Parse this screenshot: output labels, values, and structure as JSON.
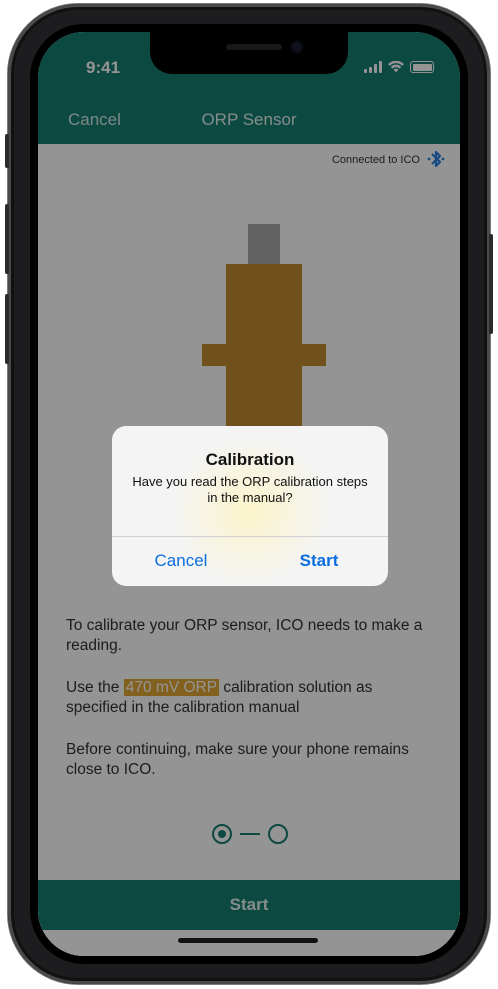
{
  "status": {
    "time": "9:41"
  },
  "nav": {
    "cancel_label": "Cancel",
    "title": "ORP Sensor"
  },
  "connection": {
    "text": "Connected to ICO",
    "icon": "bluetooth-icon"
  },
  "instructions": {
    "p1": "To calibrate your ORP sensor, ICO needs to make a reading.",
    "p2_prefix": "Use the ",
    "p2_highlight": "470 mV ORP",
    "p2_suffix": " calibration solution as specified in the calibration manual",
    "p3": "Before continuing, make sure your phone remains close to ICO."
  },
  "pagination": {
    "current": 1,
    "total": 2
  },
  "bottom": {
    "start_label": "Start"
  },
  "alert": {
    "title": "Calibration",
    "message": "Have you read the ORP calibration steps in the manual?",
    "cancel_label": "Cancel",
    "start_label": "Start"
  },
  "colors": {
    "primary": "#157e6f",
    "highlight": "#e0a834",
    "sensor_body": "#c18c2f",
    "alert_button": "#0a6ee0"
  }
}
